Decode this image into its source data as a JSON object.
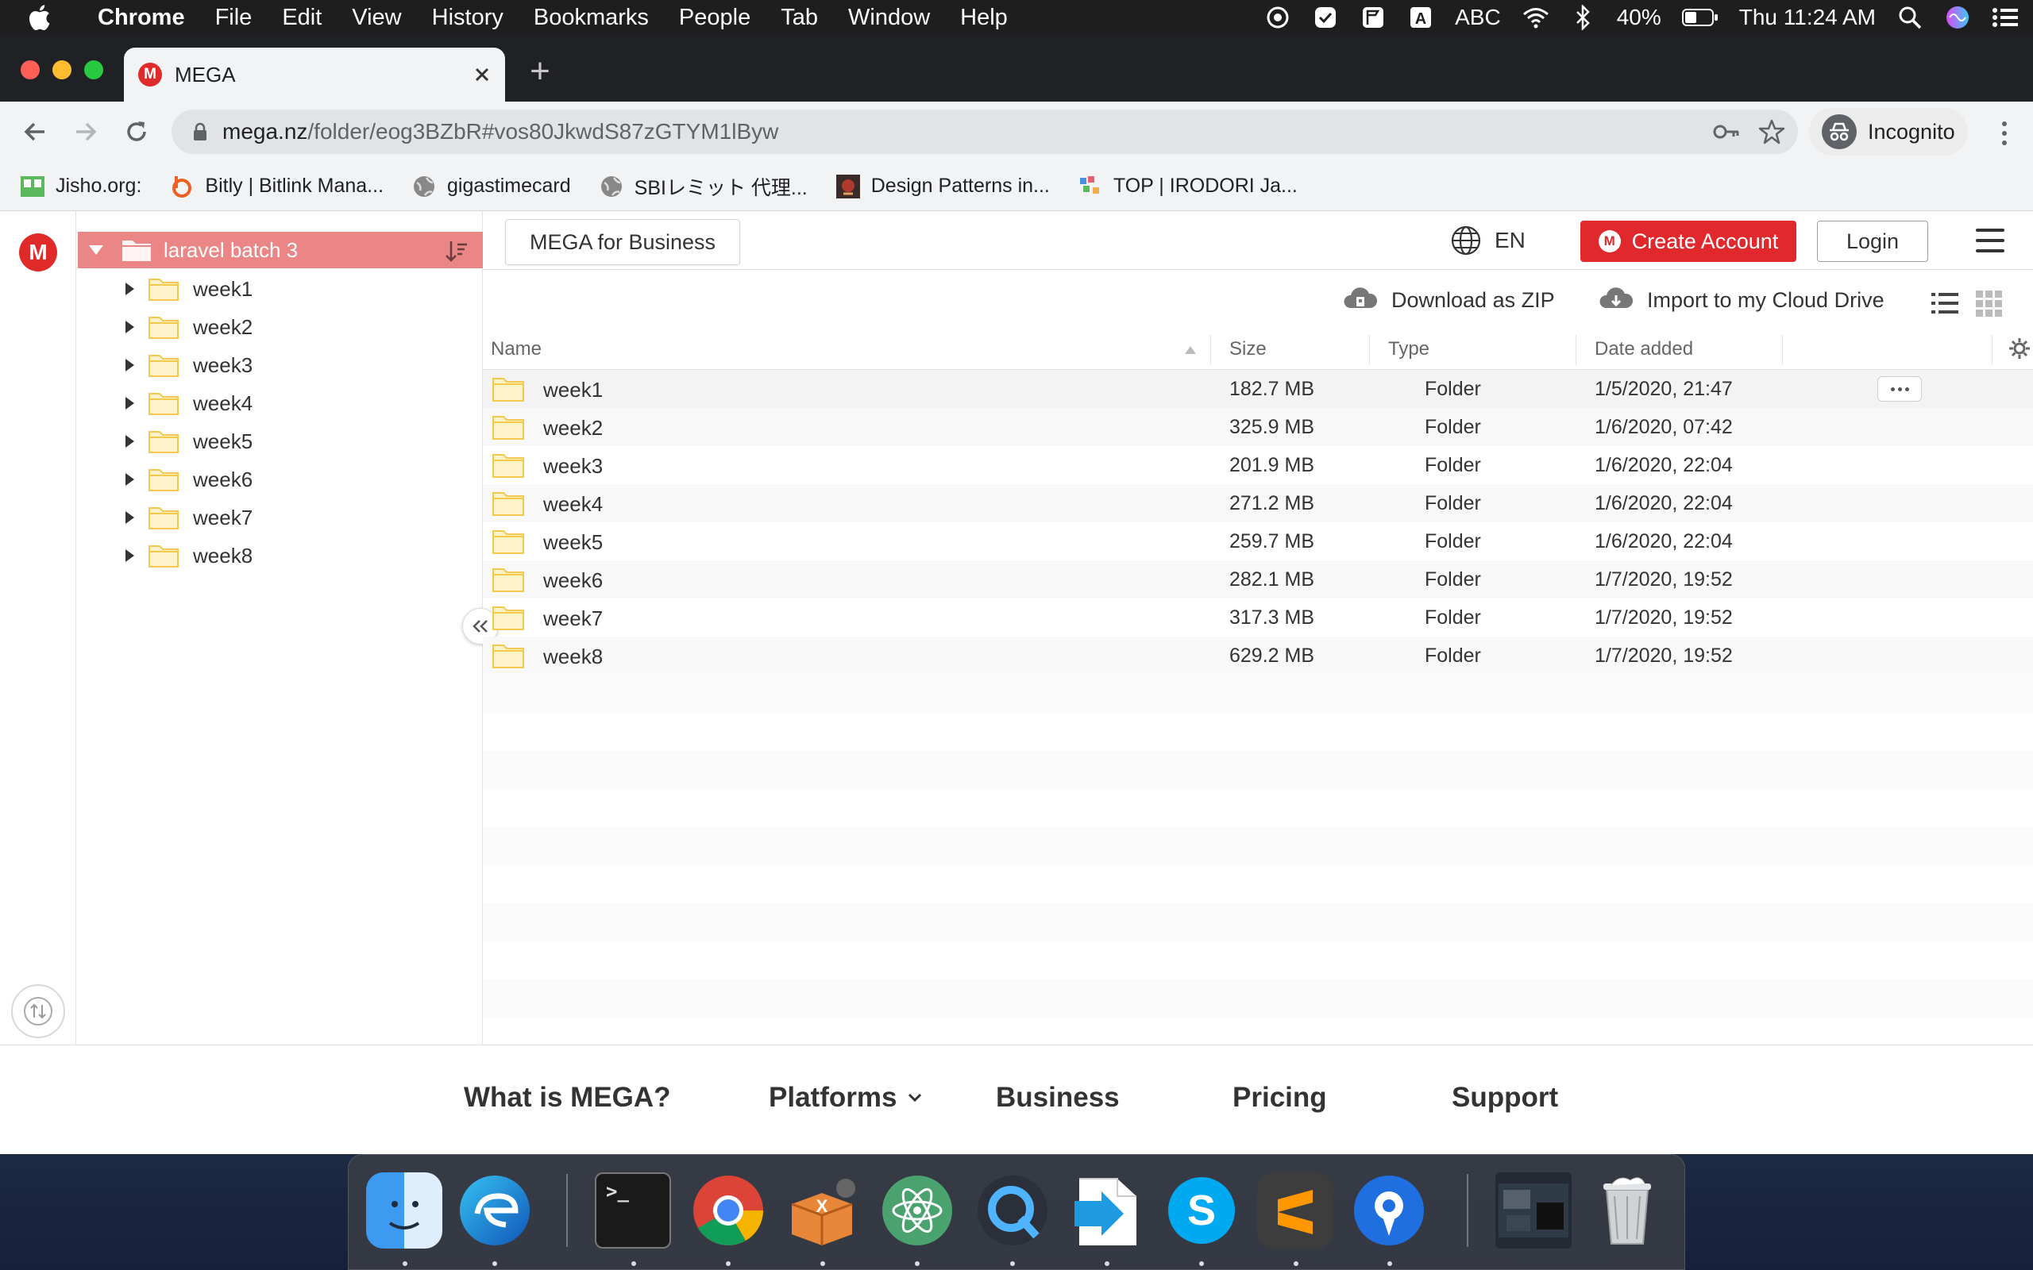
{
  "menubar": {
    "app": "Chrome",
    "items": [
      "File",
      "Edit",
      "View",
      "History",
      "Bookmarks",
      "People",
      "Tab",
      "Window",
      "Help"
    ],
    "input_source": "ABC",
    "battery": "40%",
    "clock": "Thu 11:24 AM"
  },
  "browser": {
    "tab_title": "MEGA",
    "url_host": "mega.nz",
    "url_path": "/folder/eog3BZbR#vos80JkwdS87zGTYM1lByw",
    "incognito_label": "Incognito",
    "bookmarks": [
      {
        "label": "Jisho.org:",
        "icon": "jisho-icon",
        "color": "#5cb85c"
      },
      {
        "label": "Bitly | Bitlink Mana...",
        "icon": "bitly-icon",
        "color": "#ee6123"
      },
      {
        "label": "gigastimecard",
        "icon": "globe-icon",
        "color": "#888888"
      },
      {
        "label": "SBIレミット 代理...",
        "icon": "globe-icon",
        "color": "#888888"
      },
      {
        "label": "Design Patterns in...",
        "icon": "refactoring-icon",
        "color": "#b13a2e"
      },
      {
        "label": "TOP | IRODORI Ja...",
        "icon": "irodori-icon",
        "color": "#4a90d9"
      }
    ]
  },
  "mega": {
    "business_button": "MEGA for Business",
    "language": "EN",
    "create_account": "Create Account",
    "login": "Login",
    "download_zip": "Download as ZIP",
    "import_cloud": "Import to my Cloud Drive",
    "tree": {
      "root": "laravel batch 3",
      "items": [
        "week1",
        "week2",
        "week3",
        "week4",
        "week5",
        "week6",
        "week7",
        "week8"
      ]
    },
    "table": {
      "headers": {
        "name": "Name",
        "size": "Size",
        "type": "Type",
        "date": "Date added"
      },
      "rows": [
        {
          "name": "week1",
          "size": "182.7 MB",
          "type": "Folder",
          "date": "1/5/2020, 21:47"
        },
        {
          "name": "week2",
          "size": "325.9 MB",
          "type": "Folder",
          "date": "1/6/2020, 07:42"
        },
        {
          "name": "week3",
          "size": "201.9 MB",
          "type": "Folder",
          "date": "1/6/2020, 22:04"
        },
        {
          "name": "week4",
          "size": "271.2 MB",
          "type": "Folder",
          "date": "1/6/2020, 22:04"
        },
        {
          "name": "week5",
          "size": "259.7 MB",
          "type": "Folder",
          "date": "1/6/2020, 22:04"
        },
        {
          "name": "week6",
          "size": "282.1 MB",
          "type": "Folder",
          "date": "1/7/2020, 19:52"
        },
        {
          "name": "week7",
          "size": "317.3 MB",
          "type": "Folder",
          "date": "1/7/2020, 19:52"
        },
        {
          "name": "week8",
          "size": "629.2 MB",
          "type": "Folder",
          "date": "1/7/2020, 19:52"
        }
      ]
    },
    "footer": [
      "What is MEGA?",
      "Platforms",
      "Business",
      "Pricing",
      "Support"
    ]
  },
  "dock": {
    "apps": [
      "finder-icon",
      "edge-icon",
      "terminal-icon",
      "chrome-icon",
      "xampp-icon",
      "atom-icon",
      "quicktime-icon",
      "migration-icon",
      "skype-icon",
      "sublime-icon",
      "pinpoint-icon",
      "downloads-stack-icon",
      "trash-icon"
    ]
  },
  "colors": {
    "mega_red": "#e0282d",
    "tree_selected": "#ea8686",
    "folder_yellow": "#fcd669"
  }
}
